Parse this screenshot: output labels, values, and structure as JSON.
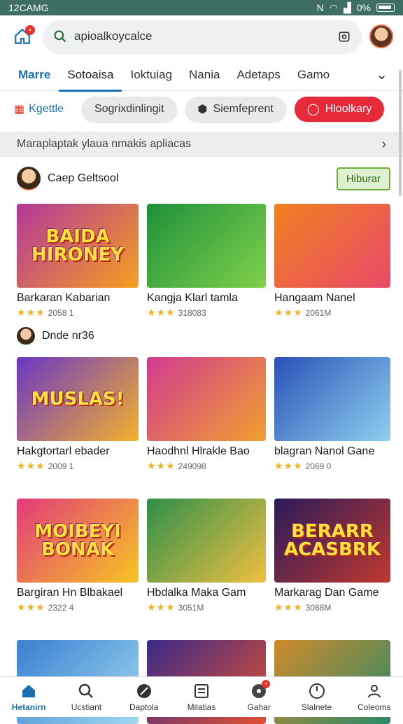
{
  "status": {
    "time": "12CAMG",
    "battery": "0%"
  },
  "search": {
    "value": "apioalkoycalce"
  },
  "tabs": [
    "Marre",
    "Sotoaisa",
    "Ioktuiag",
    "Nania",
    "Adetaps",
    "Gamo"
  ],
  "chips": {
    "link": "Kgettle",
    "c1": "Sogrixdinlingit",
    "c2": "Siemfeprent",
    "c3": "Hloolkary"
  },
  "banner": {
    "text": "Maraplaptak ylaua nmakis apliacas"
  },
  "section1": {
    "title": "Caep Geltsool",
    "action": "Hiburar"
  },
  "section2": {
    "title": "Dnde nr36"
  },
  "games": [
    {
      "name": "Barkaran Kabarian",
      "meta": "2058 1",
      "art": "BAIDA HIRONEY",
      "c1": "#b0379a",
      "c2": "#f5a020"
    },
    {
      "name": "Kangja Klarl tamla",
      "meta": "318083",
      "art": "",
      "c1": "#1f8f3a",
      "c2": "#7fd14b"
    },
    {
      "name": "Hangaam Nanel",
      "meta": "2061M",
      "art": "",
      "c1": "#f08020",
      "c2": "#e84a6a"
    },
    {
      "name": "Hakgtortarl ebader",
      "meta": "2009 1",
      "art": "MUSLAS!",
      "c1": "#6a36c7",
      "c2": "#f4b12a"
    },
    {
      "name": "Haodhnl Hlrakle Bao",
      "meta": "249098",
      "art": "",
      "c1": "#d03b8f",
      "c2": "#f0a030"
    },
    {
      "name": "blagran Nanol Gane",
      "meta": "2069 0",
      "art": "",
      "c1": "#2952b6",
      "c2": "#8fd0f0"
    },
    {
      "name": "Bargiran Hn Blbakael",
      "meta": "2322 4",
      "art": "MOIBEYI BONAK",
      "c1": "#e23a7a",
      "c2": "#f6c623"
    },
    {
      "name": "Hbdalka Maka Gam",
      "meta": "3051M",
      "art": "",
      "c1": "#2e8f4a",
      "c2": "#f0c040"
    },
    {
      "name": "Markarag Dan Game",
      "meta": "3088M",
      "art": "BERARR ACASBRK",
      "c1": "#2a1a5a",
      "c2": "#c0382f"
    },
    {
      "name": "",
      "meta": "",
      "art": "",
      "c1": "#3a7fd0",
      "c2": "#9fd8f0"
    },
    {
      "name": "",
      "meta": "",
      "art": "",
      "c1": "#3a2a8a",
      "c2": "#e05030"
    },
    {
      "name": "",
      "meta": "",
      "art": "",
      "c1": "#d08a2a",
      "c2": "#2a8a6a"
    }
  ],
  "nav": [
    "Hetanirn",
    "Ucstiant",
    "Daptola",
    "Milatias",
    "Gahar",
    "Slalnete",
    "Coleoms"
  ],
  "stars": "★★★"
}
